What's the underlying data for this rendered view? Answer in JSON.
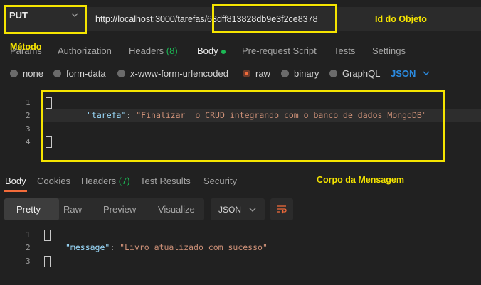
{
  "request": {
    "method": "PUT",
    "method_chevron_icon": "chevron-down-icon",
    "url_base": "http://localhost:3000/tarefas/",
    "url_id": "63dff813828db9e3f2ce8378"
  },
  "annotations": {
    "metodo": "Método",
    "id_objeto": "Id do Objeto",
    "corpo": "Corpo da Mensagem"
  },
  "request_tabs": [
    {
      "label": "Params"
    },
    {
      "label": "Authorization"
    },
    {
      "label": "Headers",
      "count": "(8)"
    },
    {
      "label": "Body"
    },
    {
      "label": "Pre-request Script"
    },
    {
      "label": "Tests"
    },
    {
      "label": "Settings"
    }
  ],
  "body_types": [
    {
      "label": "none"
    },
    {
      "label": "form-data"
    },
    {
      "label": "x-www-form-urlencoded"
    },
    {
      "label": "raw"
    },
    {
      "label": "binary"
    },
    {
      "label": "GraphQL"
    }
  ],
  "body_format": "JSON",
  "request_body": {
    "line_numbers": [
      "1",
      "2",
      "3",
      "4"
    ],
    "key": "\"tarefa\"",
    "colon": ": ",
    "value": "\"Finalizar  o CRUD integrando com o banco de dados MongoDB\""
  },
  "response_tabs": [
    {
      "label": "Body"
    },
    {
      "label": "Cookies"
    },
    {
      "label": "Headers",
      "count": "(7)"
    },
    {
      "label": "Test Results"
    },
    {
      "label": "Security"
    }
  ],
  "view_modes": [
    "Pretty",
    "Raw",
    "Preview",
    "Visualize"
  ],
  "response_format": "JSON",
  "response_body": {
    "line_numbers": [
      "1",
      "2",
      "3"
    ],
    "key": "\"message\"",
    "colon": ": ",
    "value": "\"Livro atualizado com sucesso\""
  },
  "colors": {
    "annotation": "#f5e400",
    "accent": "#f26b3a",
    "json_blue": "#2b8be0",
    "green": "#1cb955"
  }
}
